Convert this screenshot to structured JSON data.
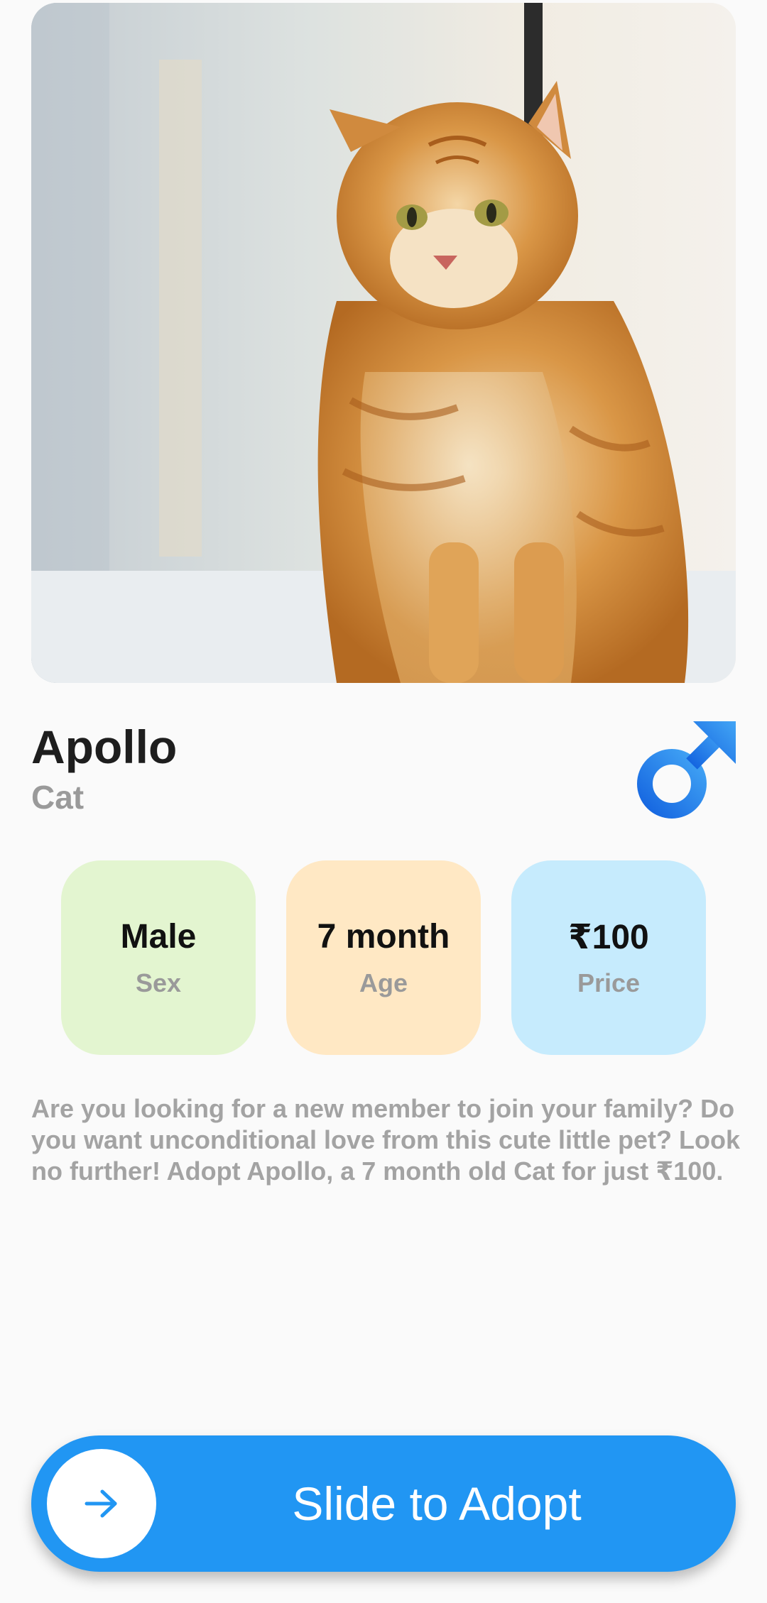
{
  "pet": {
    "name": "Apollo",
    "species": "Cat"
  },
  "icons": {
    "gender": "male-symbol-icon",
    "slider": "arrow-right-icon"
  },
  "stats": [
    {
      "value": "Male",
      "label": "Sex",
      "color": "#e3f5d0"
    },
    {
      "value": "7 month",
      "label": "Age",
      "color": "#ffe8c4"
    },
    {
      "value": "₹100",
      "label": "Price",
      "color": "#c6ebfd"
    }
  ],
  "description": "Are you looking for a new member to join your family? Do you want unconditional love from this cute little pet? Look no further! Adopt Apollo, a 7 month old Cat for just ₹100.",
  "adopt_slider": {
    "label": "Slide to Adopt"
  },
  "colors": {
    "accent": "#2196f3",
    "gender_icon": "#1e88e5"
  }
}
